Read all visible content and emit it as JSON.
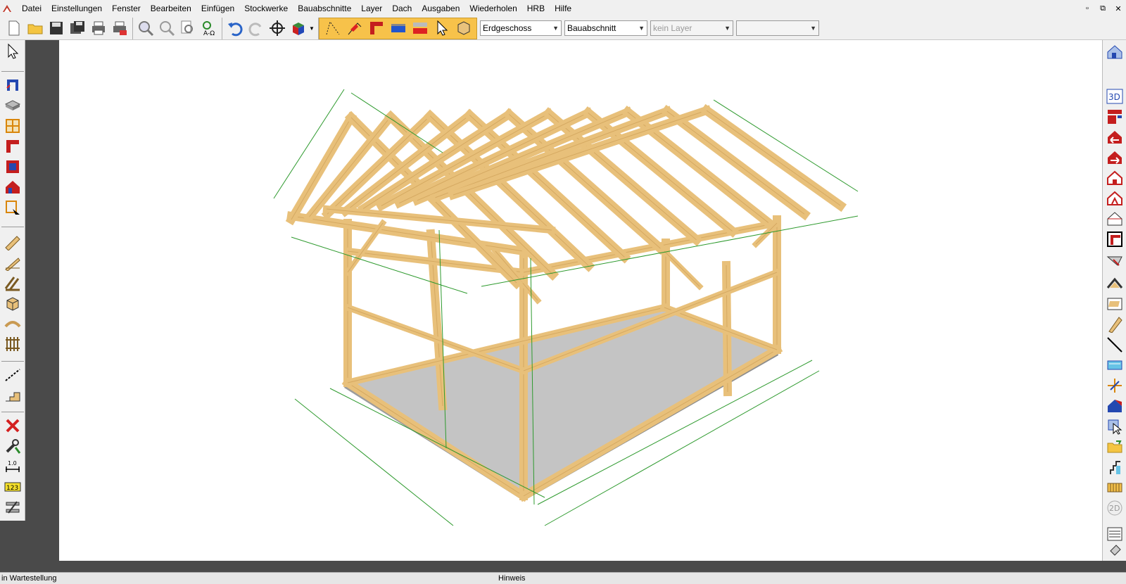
{
  "menubar": {
    "items": [
      "Datei",
      "Einstellungen",
      "Fenster",
      "Bearbeiten",
      "Einfügen",
      "Stockwerke",
      "Bauabschnitte",
      "Layer",
      "Dach",
      "Ausgaben",
      "Wiederholen",
      "HRB",
      "Hilfe"
    ],
    "window_controls": [
      "▫",
      "⧉",
      "✕"
    ]
  },
  "toolbar": {
    "floor_select": "Erdgeschoss",
    "section_select": "Bauabschnitt",
    "layer_select": "kein Layer",
    "extra_select": ""
  },
  "right_toolbar": {
    "view_3d_label": "3D",
    "view_2d_label": "2D"
  },
  "left_toolbar": {
    "dimension_label": "1.0",
    "numbering_label": "123"
  },
  "statusbar": {
    "left_text": "in Wartestellung",
    "hint_text": "Hinweis"
  },
  "colors": {
    "timber": "#e8c07a",
    "timber_dark": "#c99a52",
    "dimension": "#2e9a2e",
    "floor": "#bdbdbd",
    "highlight": "#f7c24a"
  }
}
